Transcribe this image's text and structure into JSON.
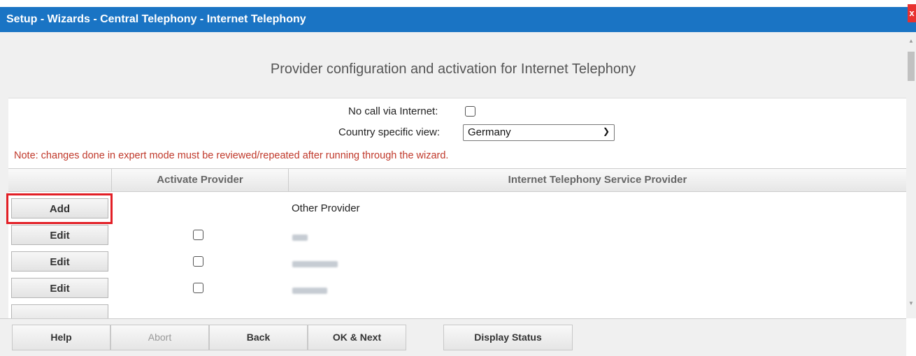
{
  "window": {
    "title": "Setup - Wizards - Central Telephony - Internet Telephony",
    "close_label": "x"
  },
  "heading": "Provider configuration and activation for Internet Telephony",
  "form": {
    "no_call_label": "No call via Internet:",
    "no_call_checked": false,
    "country_label": "Country specific view:",
    "country_value": "Germany",
    "note": "Note: changes done in expert mode must be reviewed/repeated after running through the wizard."
  },
  "table": {
    "columns": [
      "",
      "Activate Provider",
      "Internet Telephony Service Provider"
    ],
    "add_row": {
      "button": "Add",
      "provider": "Other Provider"
    },
    "rows": [
      {
        "button": "Edit",
        "checked": false,
        "provider": "[blurred]"
      },
      {
        "button": "Edit",
        "checked": false,
        "provider": "[blurred]"
      },
      {
        "button": "Edit",
        "checked": false,
        "provider": "[blurred]"
      }
    ]
  },
  "footer": {
    "help": "Help",
    "abort": "Abort",
    "back": "Back",
    "ok_next": "OK & Next",
    "display_status": "Display Status"
  },
  "colors": {
    "titlebar": "#1a74c4",
    "note": "#c0392b",
    "highlight": "#e21f26"
  }
}
